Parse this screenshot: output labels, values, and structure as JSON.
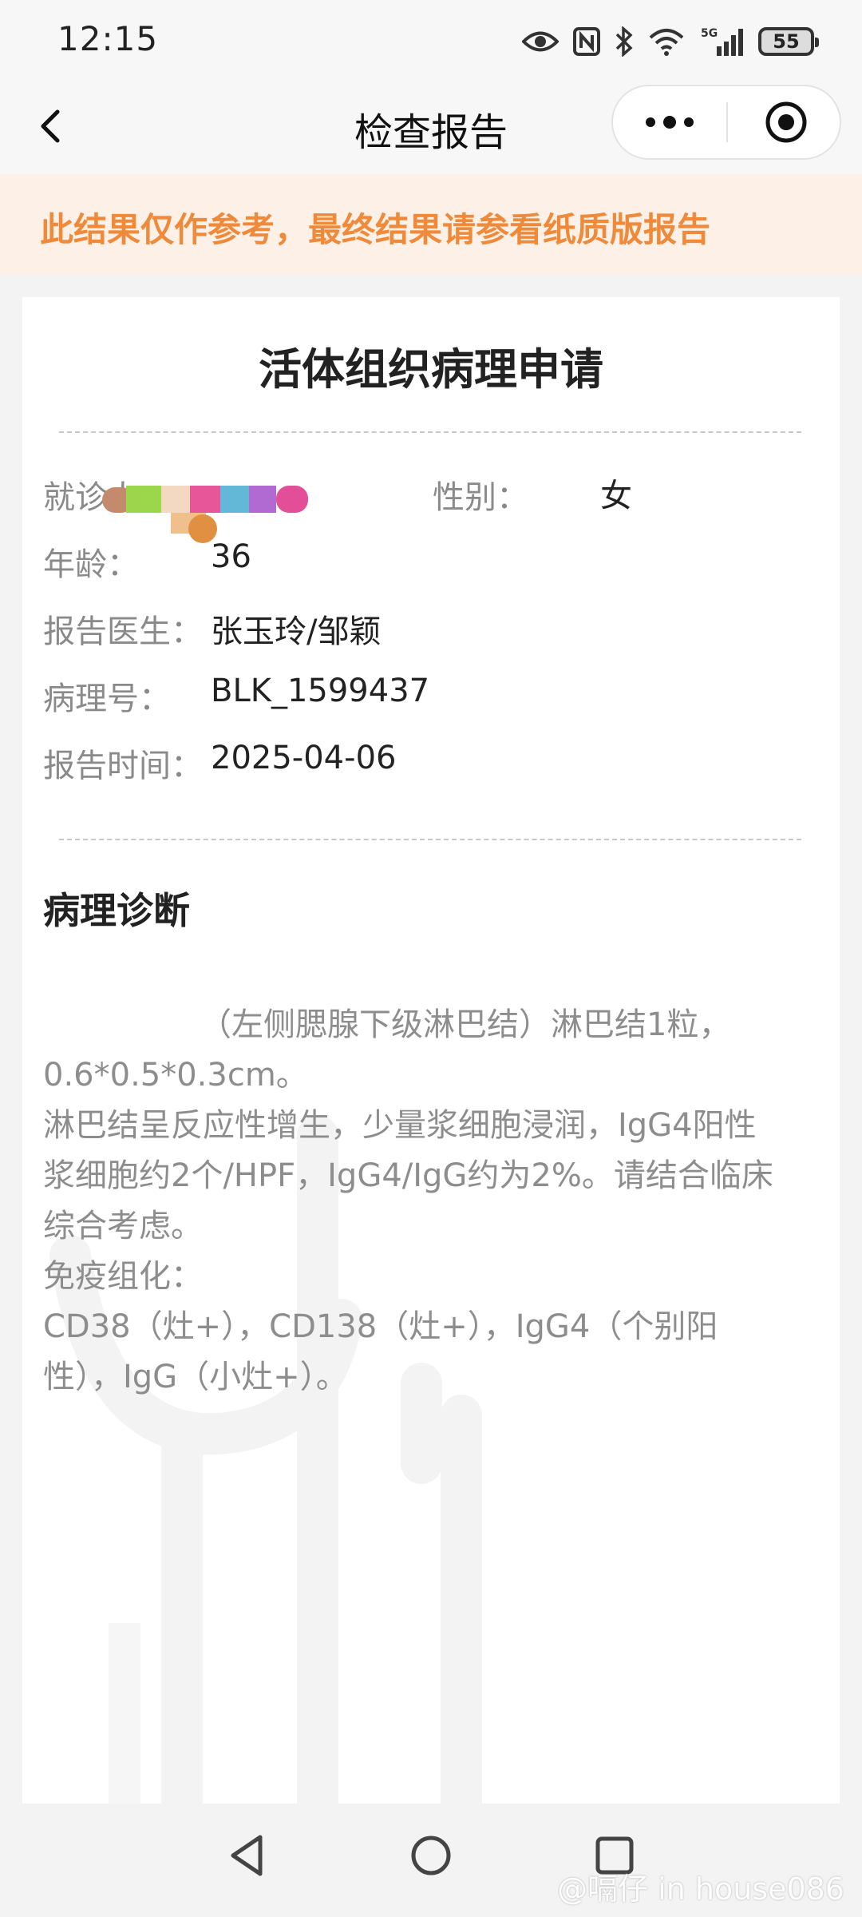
{
  "status_bar": {
    "time": "12:15",
    "battery": "55",
    "network": "5G"
  },
  "nav": {
    "title": "检查报告"
  },
  "notice": "此结果仅作参考，最终结果请参看纸质版报告",
  "report": {
    "title": "活体组织病理申请",
    "patient_label": "就诊人：",
    "gender_label": "性别：",
    "gender_value": "女",
    "age_label": "年龄：",
    "age_value": "36",
    "doctor_label": "报告医生：",
    "doctor_value": "张玉玲/邹颖",
    "path_no_label": "病理号：",
    "path_no_value": "BLK_1599437",
    "time_label": "报告时间：",
    "time_value": "2025-04-06",
    "diagnosis_title": "病理诊断",
    "diagnosis_lines": [
      "（左侧腮腺下级淋巴结）淋巴结1粒，",
      "0.6*0.5*0.3cm。",
      "淋巴结呈反应性增生，少量浆细胞浸润，IgG4阳性",
      "浆细胞约2个/HPF，IgG4/IgG约为2%。请结合临床",
      "综合考虑。",
      "免疫组化：",
      "CD38（灶+），CD138（灶+），IgG4（个别阳",
      "性），IgG（小灶+）。"
    ]
  },
  "credit": "@嗝仔 in house086",
  "colors": {
    "accent": "#ee8a3a",
    "notice_bg": "#fdf1e7",
    "card_bg": "#ffffff",
    "page_bg": "#f3f3f3"
  },
  "icons": [
    "back-arrow-icon",
    "more-icon",
    "target-icon",
    "eye-icon",
    "nfc-icon",
    "bluetooth-icon",
    "wifi-icon",
    "signal-icon",
    "battery-icon",
    "nav-back-icon",
    "nav-home-icon",
    "nav-recents-icon"
  ]
}
